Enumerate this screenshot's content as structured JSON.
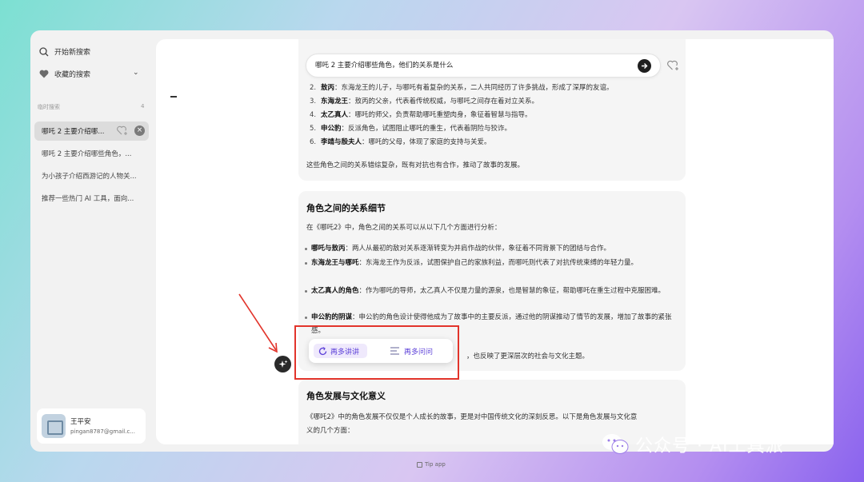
{
  "sidebar": {
    "new_search": "开始新搜索",
    "favorites": "收藏的搜索",
    "section_label": "临时搜索",
    "section_count": "4",
    "history": [
      "哪吒 2 主要介绍哪...",
      "哪吒 2 主要介绍哪些角色，...",
      "为小孩子介绍西游记的人物关...",
      "推荐一些热门 AI 工具，面向..."
    ],
    "user": {
      "name": "王平安",
      "email": "pingan8787@gmail.c..."
    }
  },
  "search": {
    "query": "哪吒 2 主要介绍哪些角色，他们的关系是什么"
  },
  "card1": {
    "items": [
      {
        "num": "2.",
        "name": "敖丙",
        "desc": "：东海龙王的儿子，与哪吒有着复杂的关系，二人共同经历了许多挑战，形成了深厚的友谊。"
      },
      {
        "num": "3.",
        "name": "东海龙王",
        "desc": "：敖丙的父亲，代表着传统权威，与哪吒之间存在着对立关系。"
      },
      {
        "num": "4.",
        "name": "太乙真人",
        "desc": "：哪吒的师父，负责帮助哪吒重塑肉身，象征着智慧与指导。"
      },
      {
        "num": "5.",
        "name": "申公豹",
        "desc": "：反派角色，试图阻止哪吒的重生，代表着阴险与狡诈。"
      },
      {
        "num": "6.",
        "name": "李靖与殷夫人",
        "desc": "：哪吒的父母，体现了家庭的支持与关爱。"
      }
    ],
    "summary": "这些角色之间的关系错综复杂，既有对抗也有合作，推动了故事的发展。"
  },
  "card2": {
    "title": "角色之间的关系细节",
    "intro": "在《哪吒2》中，角色之间的关系可以从以下几个方面进行分析：",
    "bullets": [
      {
        "name": "哪吒与敖丙",
        "desc": "：两人从最初的敌对关系逐渐转变为并肩作战的伙伴，象征着不同背景下的团结与合作。"
      },
      {
        "name": "东海龙王与哪吒",
        "desc": "：东海龙王作为反派，试图保护自己的家族利益，而哪吒则代表了对抗传统束缚的年轻力量。"
      },
      {
        "name": "太乙真人的角色",
        "desc": "：作为哪吒的导师，太乙真人不仅是力量的源泉，也是智慧的象征，帮助哪吒在重生过程中克服困难。"
      },
      {
        "name": "申公豹的阴谋",
        "desc": "：申公豹的角色设计使得他成为了故事中的主要反派，通过他的阴谋推动了情节的发展，增加了故事的紧张感。"
      }
    ],
    "trailing": "，也反映了更深层次的社会与文化主题。"
  },
  "card3": {
    "title": "角色发展与文化意义",
    "intro_line1": "《哪吒2》中的角色发展不仅仅是个人成长的故事，更是对中国传统文化的深刻反思。以下是角色发展与文化意",
    "intro_line2": "义的几个方面："
  },
  "popup": {
    "more_explain": "再多讲讲",
    "more_ask": "再多问问"
  },
  "watermark": {
    "text": "公众号 · AI工具派"
  },
  "footer": {
    "tip": "Tip app"
  },
  "colors": {
    "accent": "#5b3fd8",
    "annotation": "#e2342b"
  }
}
